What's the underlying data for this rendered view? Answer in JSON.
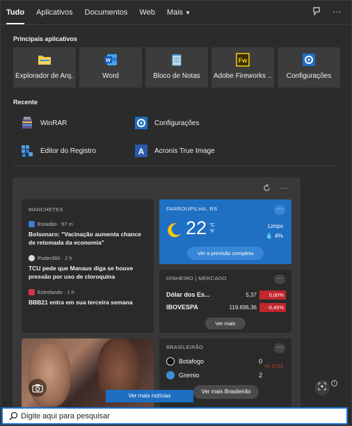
{
  "tabs": [
    {
      "label": "Tudo"
    },
    {
      "label": "Aplicativos"
    },
    {
      "label": "Documentos"
    },
    {
      "label": "Web"
    },
    {
      "label": "Mais"
    }
  ],
  "top_apps": {
    "title": "Principais aplicativos",
    "items": [
      {
        "label": "Explorador de Arq...",
        "icon": "folder-icon"
      },
      {
        "label": "Word",
        "icon": "word-icon"
      },
      {
        "label": "Bloco de Notas",
        "icon": "notepad-icon"
      },
      {
        "label": "Adobe Fireworks ...",
        "icon": "fireworks-icon"
      },
      {
        "label": "Configurações",
        "icon": "gear-icon"
      }
    ]
  },
  "recent": {
    "title": "Recente",
    "items": [
      {
        "label": "WinRAR",
        "icon": "winrar-icon"
      },
      {
        "label": "Configurações",
        "icon": "gear-icon"
      },
      {
        "label": "Editor do Registro",
        "icon": "registry-icon"
      },
      {
        "label": "Acronis True Image",
        "icon": "acronis-icon"
      }
    ]
  },
  "news": {
    "header": "MANCHETES",
    "items": [
      {
        "source": "Estadão · 57 m",
        "title": "Bolsonaro: \"Vacinação aumenta chance de retomada da economia\""
      },
      {
        "source": "Poder360 · 2 h",
        "title": "TCU pede que Manaus diga se houve pressão por uso de cloroquina"
      },
      {
        "source": "Estrelando · 1 h",
        "title": "BBB21 entra em sua terceira semana"
      }
    ],
    "more_button": "Ver mais notícias"
  },
  "weather": {
    "location": "FARROUPILHA, RS",
    "temp": "22",
    "unit_c": "°C",
    "unit_f": "°F",
    "condition": "Limpo",
    "precip": "4%",
    "button": "Ver a previsão completa"
  },
  "money": {
    "header": "DINHEIRO | MERCADO",
    "rows": [
      {
        "name": "Dólar dos Es...",
        "value": "5,37",
        "change": "0,00%"
      },
      {
        "name": "IBOVESPA",
        "value": "119.696,36",
        "change": "-0,45%"
      }
    ],
    "button": "Ver mais"
  },
  "sports": {
    "header": "BRASILEIRÃO",
    "rows": [
      {
        "team": "Botafogo",
        "score": "0"
      },
      {
        "team": "Gremio",
        "score": "2"
      }
    ],
    "status": "H1 22:51",
    "button": "Ver mais Brasileirão"
  },
  "search": {
    "placeholder": "Digite aqui para pesquisar"
  },
  "colors": {
    "weather_bg": "#1f6fc3",
    "negative": "#c2262e",
    "live": "#e0432e",
    "search_border": "#1a73d9"
  }
}
